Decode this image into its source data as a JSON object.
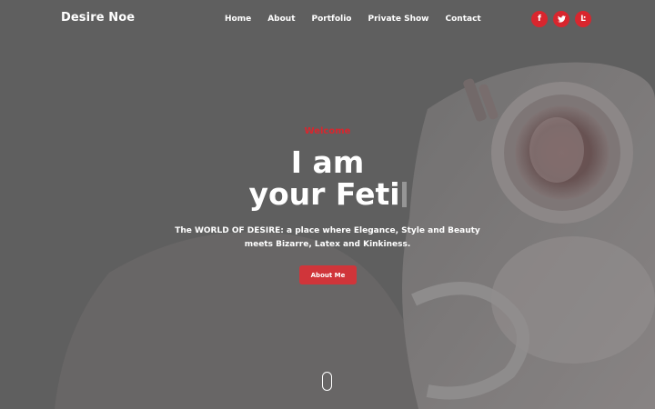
{
  "brand": "Desire Noe",
  "nav": {
    "links": [
      "Home",
      "About",
      "Portfolio",
      "Private Show",
      "Contact"
    ]
  },
  "socials": [
    {
      "icon": "facebook-icon",
      "glyph": "f"
    },
    {
      "icon": "twitter-icon",
      "glyph": "t"
    },
    {
      "icon": "onlyfans-icon",
      "glyph": "Ŀ"
    }
  ],
  "hero": {
    "welcome": "Welcome",
    "line1": "I am",
    "line2": "your Feti",
    "tagline_line1": "The WORLD OF DESIRE: a place where Elegance, Style and Beauty",
    "tagline_line2": "meets Bizarre, Latex and Kinkiness.",
    "button": "About Me"
  },
  "colors": {
    "accent": "#d8262e",
    "button": "#d0353a",
    "overlay": "#616161"
  }
}
